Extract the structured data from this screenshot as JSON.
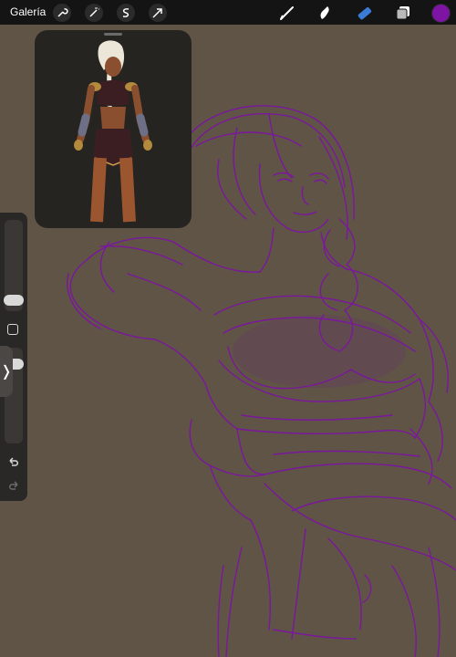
{
  "topbar": {
    "gallery_label": "Galería",
    "left_tools": [
      "wrench-icon",
      "magic-wand-icon",
      "selection-icon",
      "transform-arrow-icon"
    ],
    "right_tools": [
      "brush-icon",
      "smudge-icon",
      "eraser-icon",
      "layers-icon"
    ],
    "active_tool": "eraser-icon",
    "colors": {
      "eraser_active": "#3a7bd5",
      "current_color": "#7d14a3"
    }
  },
  "canvas": {
    "background": "#5f5445",
    "sketch_color": "#7d14a3"
  },
  "reference": {
    "title": "",
    "background": "#262421"
  },
  "sidebar": {
    "size_slider_level": 0.1,
    "opacity_slider_level": 0.65,
    "toggle_glyph": "❭"
  }
}
